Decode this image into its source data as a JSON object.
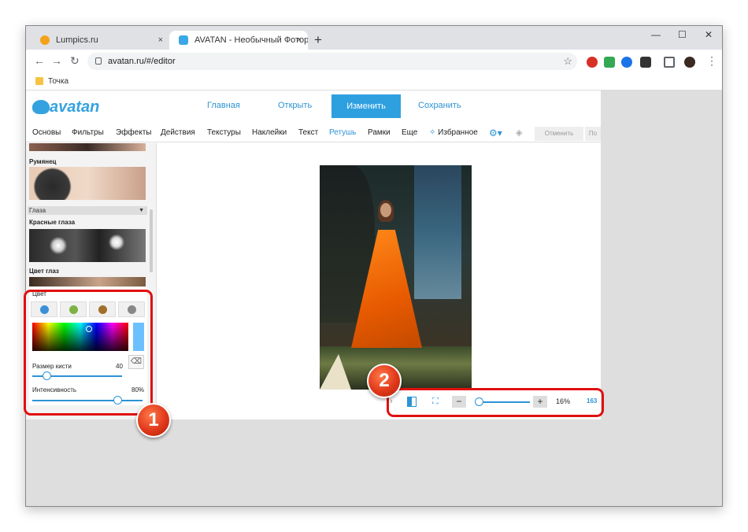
{
  "browser": {
    "tabs": [
      {
        "title": "Lumpics.ru",
        "close": "×"
      },
      {
        "title": "AVATAN - Необычный Фоторед",
        "close": "×"
      }
    ],
    "new_tab": "+",
    "window_controls": {
      "minimize": "—",
      "maximize": "☐",
      "close": "✕"
    },
    "nav": {
      "back": "←",
      "forward": "→",
      "reload": "↻"
    },
    "url": "avatan.ru/#/editor",
    "bookmark_star": "☆",
    "menu": "⋮",
    "bookmarks": [
      {
        "label": "Точка"
      }
    ]
  },
  "app": {
    "logo_text": "avatan",
    "top_nav": {
      "home": "Главная",
      "open": "Открыть",
      "edit": "Изменить",
      "save": "Сохранить"
    },
    "menu": [
      "Основы",
      "Фильтры",
      "Эффекты",
      "Действия",
      "Текстуры",
      "Наклейки",
      "Текст",
      "Ретушь",
      "Рамки",
      "Еще"
    ],
    "active_menu": "Ретушь",
    "favorites": "Избранное",
    "undo": "Отменить",
    "redo": "По"
  },
  "left_panel": {
    "blush_label": "Румянец",
    "eyes_section": "Глаза",
    "red_eyes_label": "Красные глаза",
    "eye_color_label": "Цвет глаз",
    "color_title": "Цвет",
    "eye_swatches": [
      "#3a8fd6",
      "#7cb342",
      "#a0702a",
      "#888888"
    ],
    "brush_size_label": "Размер кисти",
    "brush_size_value": "40",
    "brush_size_fraction": 0.13,
    "intensity_label": "Интенсивность",
    "intensity_value": "80%",
    "intensity_fraction": 0.8,
    "selected_color": "#6cc0ff"
  },
  "zoom_bar": {
    "zoom_out": "−",
    "zoom_in": "+",
    "zoom_percent": "16%",
    "size_text": "163",
    "zoom_fraction": 0.0
  },
  "callouts": [
    "1",
    "2"
  ]
}
